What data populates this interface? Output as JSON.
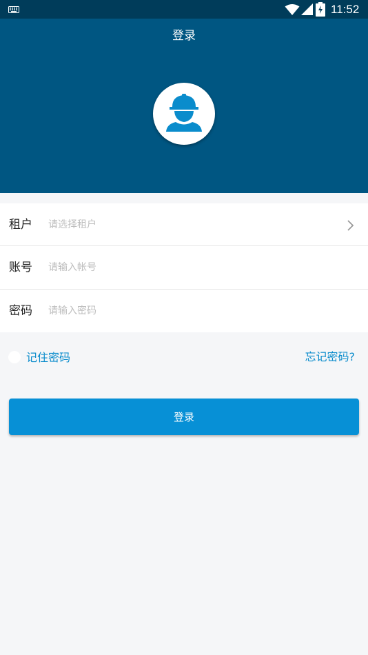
{
  "status_bar": {
    "time": "11:52",
    "icons": [
      "keyboard-icon",
      "wifi-icon",
      "signal-icon",
      "battery-icon"
    ]
  },
  "header": {
    "title": "登录",
    "avatar_icon": "worker-helmet-icon"
  },
  "form": {
    "tenant": {
      "label": "租户",
      "placeholder": "请选择租户",
      "value": ""
    },
    "account": {
      "label": "账号",
      "placeholder": "请输入帐号",
      "value": ""
    },
    "password": {
      "label": "密码",
      "placeholder": "请输入密码",
      "value": ""
    }
  },
  "options": {
    "remember_label": "记住密码",
    "remember_checked": false,
    "forgot_label": "忘记密码?"
  },
  "login_button": {
    "label": "登录"
  },
  "colors": {
    "status_bar": "#003c5a",
    "header": "#005682",
    "accent": "#0790d6",
    "link": "#0a8ccc",
    "background": "#f5f6f8"
  }
}
